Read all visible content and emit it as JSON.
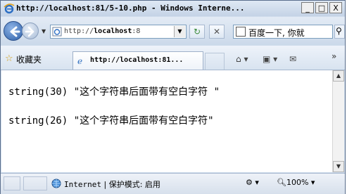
{
  "window": {
    "title": "http://localhost:81/5-10.php - Windows Interne...",
    "controls": {
      "minimize": "_",
      "maximize": "□",
      "close": "X"
    }
  },
  "nav": {
    "address_prefix": "http://",
    "address_host": "localhost",
    "address_suffix": ":8",
    "search_text": "百度一下, 你就"
  },
  "favorites": {
    "label": "收藏夹",
    "tab_title": "http://localhost:81..."
  },
  "content": {
    "lines": [
      "string(30) \"这个字符串后面带有空白字符 \"",
      "string(26) \"这个字符串后面带有空白字符\""
    ]
  },
  "status": {
    "zone_name": "Internet",
    "separator": "|",
    "protected_mode": "保护模式: 启用",
    "zoom": "100%"
  },
  "icons": [
    "ie-logo-icon",
    "back-arrow-icon",
    "forward-arrow-icon",
    "page-icon",
    "refresh-icon",
    "stop-icon",
    "baidu-icon",
    "search-icon",
    "star-icon",
    "home-icon",
    "feeds-icon",
    "mail-icon",
    "globe-icon",
    "zoom-icon"
  ]
}
